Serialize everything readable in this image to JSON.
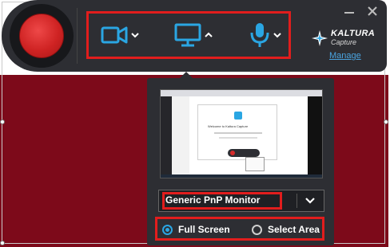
{
  "colors": {
    "accent": "#2aa6e3",
    "record_red": "#d62a2a",
    "highlight_red": "#e11d1d",
    "toolbar_bg": "#2d2e33",
    "backdrop": "#7d0a1a",
    "link": "#4aa3df"
  },
  "toolbar": {
    "record_button": {
      "icon": "record-icon"
    },
    "sources": [
      {
        "name": "camera",
        "icon": "camera-icon",
        "chevron": "chevron-down-icon"
      },
      {
        "name": "screen",
        "icon": "monitor-icon",
        "chevron": "chevron-up-icon"
      },
      {
        "name": "microphone",
        "icon": "microphone-icon",
        "chevron": "chevron-down-icon"
      }
    ],
    "window_controls": {
      "minimize_icon": "minimize-icon",
      "close_icon": "close-icon"
    }
  },
  "brand": {
    "logo_text": "KALTURA",
    "logo_subtext": "Capture",
    "manage_link": "Manage"
  },
  "screen_panel": {
    "preview": {
      "dialog_text": "Welcome to Kaltura Capture"
    },
    "monitor": {
      "selected": "Generic PnP Monitor"
    },
    "capture_modes": [
      {
        "label": "Full Screen",
        "selected": true
      },
      {
        "label": "Select Area",
        "selected": false
      }
    ]
  }
}
